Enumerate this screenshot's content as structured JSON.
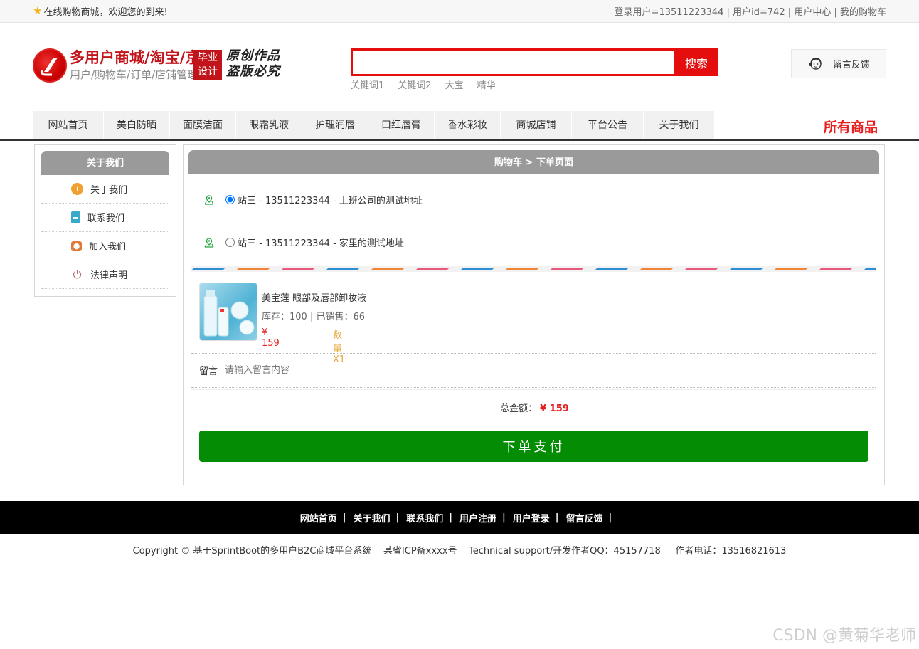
{
  "topbar": {
    "welcome": "在线购物商城，欢迎您的到来!",
    "user_label": "登录用户=13511223344",
    "userid_label": "用户id=742",
    "user_center": "用户中心",
    "my_cart": "我的购物车"
  },
  "header": {
    "logo_title": "多用户商城/淘宝/京东",
    "logo_sub": "用户/购物车/订单/店铺管理",
    "badge_line1": "毕业",
    "badge_line2": "设计",
    "slogan_line1": "原创作品",
    "slogan_line2": "盗版必究",
    "search_placeholder": "",
    "search_button": "搜索",
    "keywords": [
      "关键词1",
      "关键词2",
      "大宝",
      "精华"
    ],
    "feedback": "留言反馈"
  },
  "nav": {
    "items": [
      "网站首页",
      "美白防晒",
      "面膜洁面",
      "眼霜乳液",
      "护理润唇",
      "口红唇膏",
      "香水彩妆",
      "商城店铺",
      "平台公告",
      "关于我们"
    ],
    "all_goods": "所有商品"
  },
  "sidebar": {
    "title": "关于我们",
    "items": [
      {
        "label": "关于我们",
        "icon": "info-icon",
        "color": "#f0a030"
      },
      {
        "label": "联系我们",
        "icon": "clipboard-icon",
        "color": "#3aa8c8"
      },
      {
        "label": "加入我们",
        "icon": "lock-icon",
        "color": "#e07a3a"
      },
      {
        "label": "法律声明",
        "icon": "power-icon",
        "color": "#b07070"
      }
    ]
  },
  "order": {
    "title": "购物车 > 下单页面",
    "addresses": [
      {
        "label": "站三 - 13511223344 - 上班公司的测试地址",
        "selected": true
      },
      {
        "label": "站三 - 13511223344 - 家里的测试地址",
        "selected": false
      }
    ],
    "product": {
      "name": "美宝莲 眼部及唇部卸妆液",
      "stock": "库存：100 | 已销售：66",
      "price": "¥ 159",
      "qty": "数量 X1"
    },
    "message_label": "留言",
    "message_placeholder": "请输入留言内容",
    "total_label": "总金额：",
    "total_value": "¥ 159",
    "pay_button": "下单支付"
  },
  "footer": {
    "links": [
      "网站首页",
      "关于我们",
      "联系我们",
      "用户注册",
      "用户登录",
      "留言反馈"
    ],
    "copyright": "Copyright © 基于SprintBoot的多用户B2C商城平台系统    某省ICP备xxxx号    Technical support/开发作者QQ：45157718     作者电话：13516821613"
  },
  "watermark": "CSDN @黄菊华老师",
  "colors": {
    "brand_red": "#c2151b",
    "search_red": "#e50e0e",
    "pay_green": "#038c04",
    "price_red": "#e61e1e"
  }
}
